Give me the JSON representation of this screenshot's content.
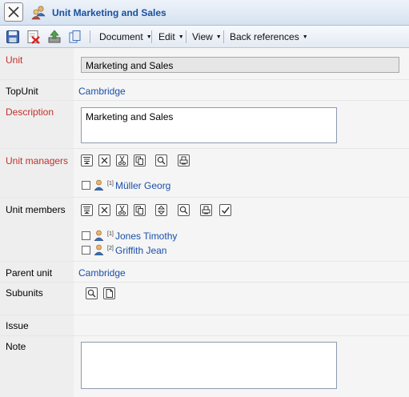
{
  "window": {
    "title": "Unit Marketing and Sales"
  },
  "toolbar": {
    "icons": [
      "save-icon",
      "delete-icon",
      "upload-icon",
      "copy-icon"
    ],
    "menus": [
      {
        "label": "Document"
      },
      {
        "label": "Edit"
      },
      {
        "label": "View"
      },
      {
        "label": "Back references"
      }
    ]
  },
  "fields": {
    "unit": {
      "label": "Unit",
      "value": "Marketing and Sales"
    },
    "topunit": {
      "label": "TopUnit",
      "value": "Cambridge"
    },
    "description": {
      "label": "Description",
      "value": "Marketing and Sales"
    },
    "managers": {
      "label": "Unit managers",
      "items": [
        {
          "index": "[1]",
          "name": "Müller Georg"
        }
      ]
    },
    "members": {
      "label": "Unit members",
      "items": [
        {
          "index": "[1]",
          "name": "Jones Timothy"
        },
        {
          "index": "[2]",
          "name": "Griffith Jean"
        }
      ]
    },
    "parent": {
      "label": "Parent unit",
      "value": "Cambridge"
    },
    "subunits": {
      "label": "Subunits"
    },
    "issue": {
      "label": "Issue",
      "value": ""
    },
    "note": {
      "label": "Note",
      "value": ""
    }
  },
  "colors": {
    "required_label": "#c0302c",
    "link": "#1a4fa8",
    "title": "#1a4f9c"
  }
}
